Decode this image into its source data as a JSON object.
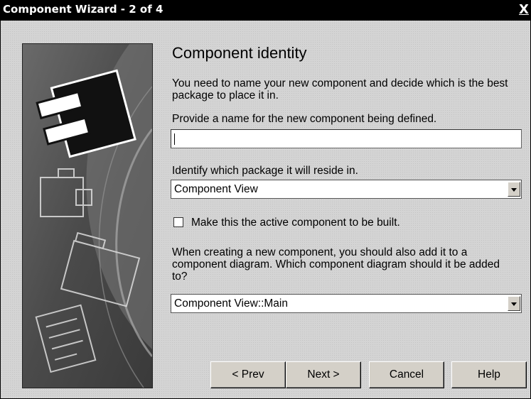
{
  "window": {
    "title": "Component Wizard - 2 of 4",
    "close_label": "X"
  },
  "content": {
    "heading": "Component identity",
    "intro": "You need to name your new component and decide which is the best package to place it in.",
    "name_prompt": "Provide a name for the new component being defined.",
    "name_value": "",
    "package_prompt": "Identify which package it will reside in.",
    "package_value": "Component View",
    "active_checkbox_label": "Make this the active component to be built.",
    "active_checked": false,
    "diagram_prompt": "When creating a new component, you should also add it to a component diagram. Which component diagram should it be added to?",
    "diagram_value": "Component View::Main"
  },
  "buttons": {
    "prev": "< Prev",
    "next": "Next >",
    "cancel": "Cancel",
    "help": "Help"
  }
}
